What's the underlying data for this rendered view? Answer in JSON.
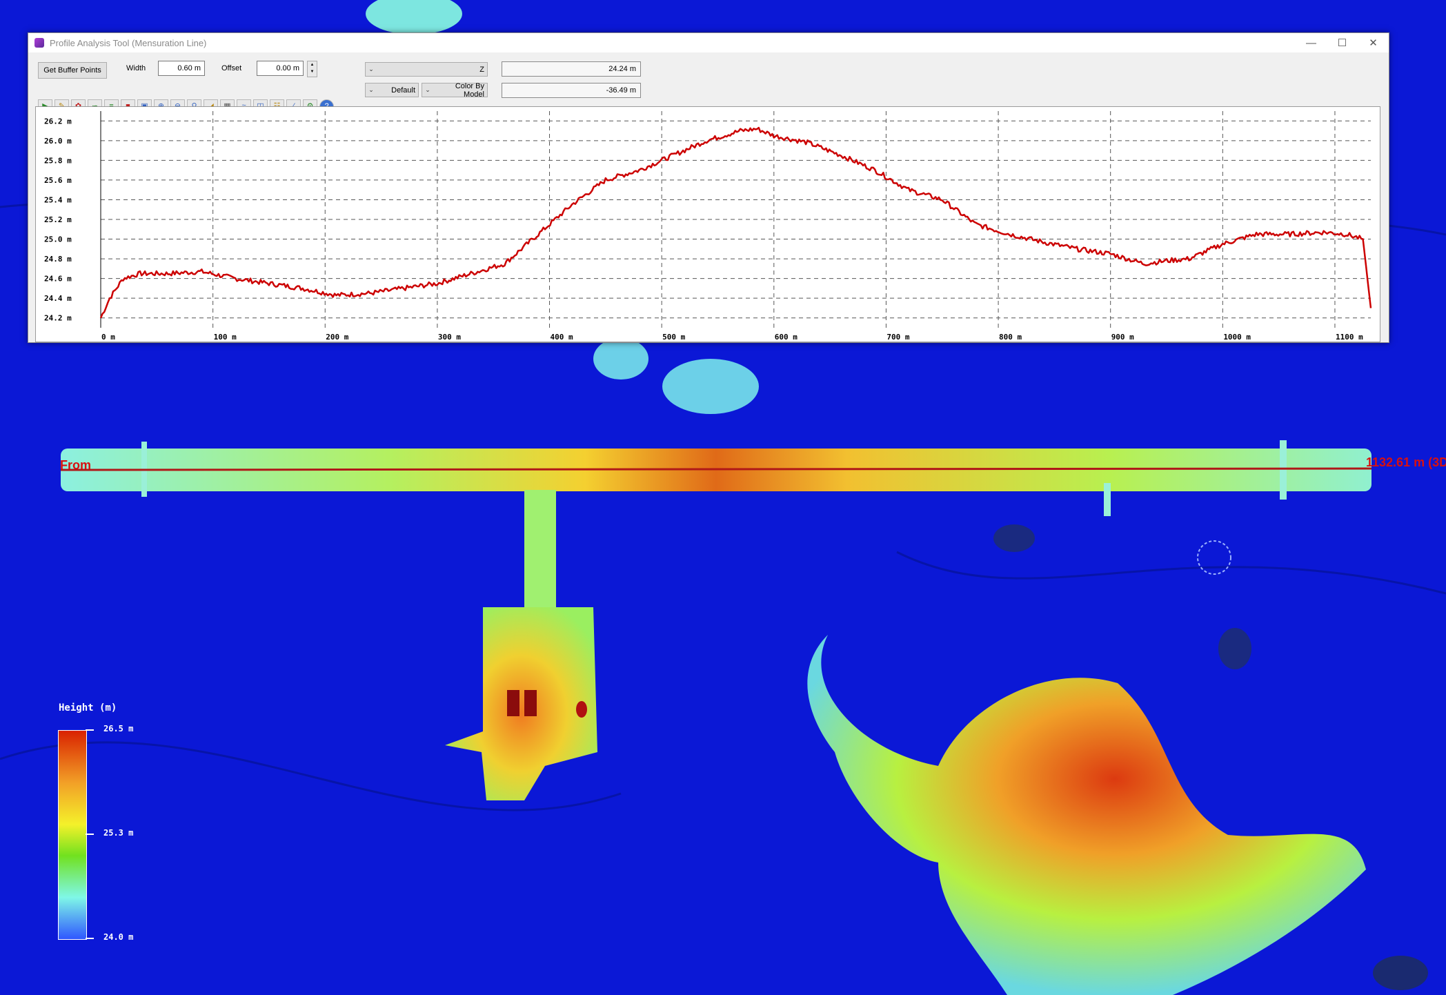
{
  "window": {
    "title": "Profile Analysis Tool (Mensuration Line)",
    "controls": [
      "minimize",
      "maximize",
      "close"
    ]
  },
  "toolbar": {
    "get_buffer_label": "Get Buffer Points",
    "width_label": "Width",
    "width_value": "0.60 m",
    "offset_label": "Offset",
    "offset_value": "0.00 m",
    "axis_combo": "Z",
    "style_combo": "Default",
    "color_combo": "Color By Model",
    "readout_top": "24.24 m",
    "readout_bottom": "-36.49 m",
    "tool_icons": [
      "play-icon",
      "pencil-icon",
      "bird-icon",
      "curve-icon",
      "track-icon",
      "stop-icon",
      "fit-icon",
      "zoom-in-icon",
      "zoom-out-icon",
      "zoom-icon",
      "measure-icon",
      "table-icon",
      "chart-icon",
      "columns-icon",
      "clipboard-icon",
      "line-icon",
      "settings-icon",
      "help-icon"
    ]
  },
  "chart_data": {
    "type": "line",
    "title": "",
    "xlabel": "",
    "ylabel": "",
    "xlim": [
      0,
      1132
    ],
    "ylim": [
      24.1,
      26.3
    ],
    "x_ticks": [
      "0 m",
      "100 m",
      "200 m",
      "300 m",
      "400 m",
      "500 m",
      "600 m",
      "700 m",
      "800 m",
      "900 m",
      "1000 m",
      "1100 m"
    ],
    "y_ticks": [
      "26.2 m",
      "26.0 m",
      "25.8 m",
      "25.6 m",
      "25.4 m",
      "25.2 m",
      "25.0 m",
      "24.8 m",
      "24.6 m",
      "24.4 m",
      "24.2 m"
    ],
    "grid": true,
    "series": [
      {
        "color": "#cc0000",
        "x": [
          0,
          8,
          20,
          35,
          60,
          90,
          120,
          150,
          180,
          210,
          240,
          270,
          300,
          330,
          360,
          390,
          420,
          450,
          480,
          510,
          540,
          570,
          585,
          600,
          630,
          660,
          690,
          720,
          750,
          780,
          810,
          840,
          870,
          900,
          930,
          950,
          970,
          1000,
          1030,
          1060,
          1090,
          1110,
          1125,
          1132
        ],
        "y": [
          24.2,
          24.4,
          24.6,
          24.65,
          24.65,
          24.67,
          24.6,
          24.55,
          24.5,
          24.43,
          24.45,
          24.5,
          24.55,
          24.65,
          24.75,
          25.05,
          25.35,
          25.6,
          25.7,
          25.85,
          26.0,
          26.1,
          26.12,
          26.05,
          25.98,
          25.85,
          25.7,
          25.5,
          25.4,
          25.15,
          25.05,
          24.97,
          24.9,
          24.85,
          24.75,
          24.78,
          24.8,
          24.95,
          25.05,
          25.05,
          25.07,
          25.05,
          25.0,
          24.3
        ]
      }
    ]
  },
  "overlay": {
    "from_label": "From",
    "distance_label": "1132.61 m (3D"
  },
  "legend": {
    "title": "Height (m)",
    "max": "26.5 m",
    "mid": "25.3 m",
    "min": "24.0 m"
  },
  "colors": {
    "background": "#0a14d8",
    "profile_line": "#cc0000",
    "high": "#d92200",
    "low": "#2f57ff"
  }
}
